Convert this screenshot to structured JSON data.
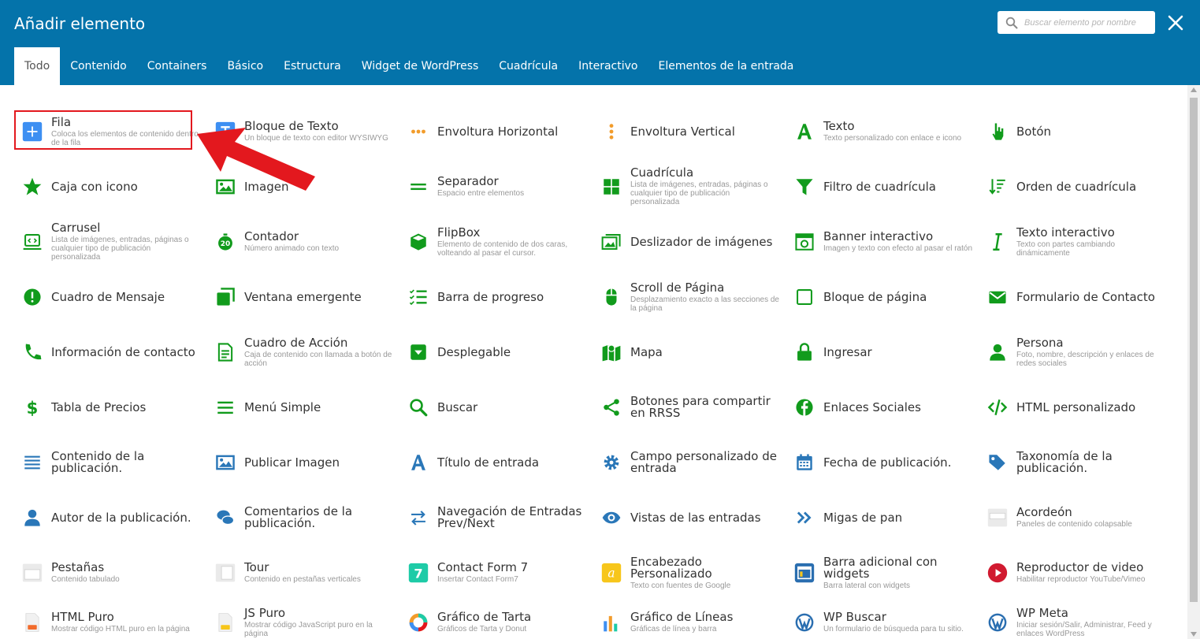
{
  "header": {
    "title": "Añadir elemento",
    "search_placeholder": "Buscar elemento por nombre",
    "colors": {
      "bar": "#0473aa",
      "icon_green": "#119b1c",
      "icon_blue": "#2a77b8",
      "highlight": "#e3181e"
    }
  },
  "tabs": [
    {
      "label": "Todo",
      "active": true
    },
    {
      "label": "Contenido"
    },
    {
      "label": "Containers"
    },
    {
      "label": "Básico"
    },
    {
      "label": "Estructura"
    },
    {
      "label": "Widget de WordPress"
    },
    {
      "label": "Cuadrícula"
    },
    {
      "label": "Interactivo"
    },
    {
      "label": "Elementos de la entrada"
    }
  ],
  "elements": [
    {
      "name": "Fila",
      "desc": "Coloca los elementos de contenido dentro de la fila",
      "icon": "plus-icon"
    },
    {
      "name": "Bloque de Texto",
      "desc": "Un bloque de texto con editor WYSIWYG",
      "icon": "text-block-icon"
    },
    {
      "name": "Envoltura Horizontal",
      "desc": "",
      "icon": "dots-horizontal-icon"
    },
    {
      "name": "Envoltura Vertical",
      "desc": "",
      "icon": "dots-vertical-icon"
    },
    {
      "name": "Texto",
      "desc": "Texto personalizado con enlace e icono",
      "icon": "font-a-icon"
    },
    {
      "name": "Botón",
      "desc": "",
      "icon": "pointer-hand-icon"
    },
    {
      "name": "Caja con icono",
      "desc": "",
      "icon": "star-icon"
    },
    {
      "name": "Imagen",
      "desc": "",
      "icon": "image-icon"
    },
    {
      "name": "Separador",
      "desc": "Espacio entre elementos",
      "icon": "separator-icon"
    },
    {
      "name": "Cuadrícula",
      "desc": "Lista de imágenes, entradas, páginas o cualquier tipo de publicación personalizada",
      "icon": "grid-icon"
    },
    {
      "name": "Filtro de cuadrícula",
      "desc": "",
      "icon": "filter-icon"
    },
    {
      "name": "Orden de cuadrícula",
      "desc": "",
      "icon": "sort-icon"
    },
    {
      "name": "Carrusel",
      "desc": "Lista de imágenes, entradas, páginas o cualquier tipo de publicación personalizada",
      "icon": "carousel-icon"
    },
    {
      "name": "Contador",
      "desc": "Número animado con texto",
      "icon": "counter-icon"
    },
    {
      "name": "FlipBox",
      "desc": "Elemento de contenido de dos caras, volteando al pasar el cursor.",
      "icon": "cube-icon"
    },
    {
      "name": "Deslizador de imágenes",
      "desc": "",
      "icon": "images-icon"
    },
    {
      "name": "Banner interactivo",
      "desc": "Imagen y texto con efecto al pasar el ratón",
      "icon": "banner-icon"
    },
    {
      "name": "Texto interactivo",
      "desc": "Texto con partes cambiando dinámicamente",
      "icon": "italic-i-icon"
    },
    {
      "name": "Cuadro de Mensaje",
      "desc": "",
      "icon": "exclamation-circle-icon"
    },
    {
      "name": "Ventana emergente",
      "desc": "",
      "icon": "window-icon"
    },
    {
      "name": "Barra de progreso",
      "desc": "",
      "icon": "tasks-icon"
    },
    {
      "name": "Scroll de Página",
      "desc": "Desplazamiento exacto a las secciones de la página",
      "icon": "mouse-icon"
    },
    {
      "name": "Bloque de página",
      "desc": "",
      "icon": "square-outline-icon"
    },
    {
      "name": "Formulario de Contacto",
      "desc": "",
      "icon": "envelope-icon"
    },
    {
      "name": "Información de contacto",
      "desc": "",
      "icon": "phone-icon"
    },
    {
      "name": "Cuadro de Acción",
      "desc": "Caja de contenido con llamada a botón de acción",
      "icon": "file-text-icon"
    },
    {
      "name": "Desplegable",
      "desc": "",
      "icon": "dropdown-icon"
    },
    {
      "name": "Mapa",
      "desc": "",
      "icon": "map-icon"
    },
    {
      "name": "Ingresar",
      "desc": "",
      "icon": "lock-icon"
    },
    {
      "name": "Persona",
      "desc": "Foto, nombre, descripción y enlaces de redes sociales",
      "icon": "user-icon"
    },
    {
      "name": "Tabla de Precios",
      "desc": "",
      "icon": "dollar-icon"
    },
    {
      "name": "Menú Simple",
      "desc": "",
      "icon": "menu-bars-icon"
    },
    {
      "name": "Buscar",
      "desc": "",
      "icon": "search-icon"
    },
    {
      "name": "Botones para compartir en RRSS",
      "desc": "",
      "icon": "share-icon"
    },
    {
      "name": "Enlaces Sociales",
      "desc": "",
      "icon": "facebook-icon"
    },
    {
      "name": "HTML personalizado",
      "desc": "",
      "icon": "code-icon"
    },
    {
      "name": "Contenido de la publicación.",
      "desc": "",
      "icon": "align-lines-icon"
    },
    {
      "name": "Publicar Imagen",
      "desc": "",
      "icon": "post-image-icon"
    },
    {
      "name": "Título de entrada",
      "desc": "",
      "icon": "font-a-icon"
    },
    {
      "name": "Campo personalizado de entrada",
      "desc": "",
      "icon": "cog-icon"
    },
    {
      "name": "Fecha de publicación.",
      "desc": "",
      "icon": "calendar-icon"
    },
    {
      "name": "Taxonomía de la publicación.",
      "desc": "",
      "icon": "tags-icon"
    },
    {
      "name": "Autor de la publicación.",
      "desc": "",
      "icon": "author-icon"
    },
    {
      "name": "Comentarios de la publicación.",
      "desc": "",
      "icon": "comments-icon"
    },
    {
      "name": "Navegación de Entradas Prev/Next",
      "desc": "",
      "icon": "exchange-arrows-icon"
    },
    {
      "name": "Vistas de las entradas",
      "desc": "",
      "icon": "eye-icon"
    },
    {
      "name": "Migas de pan",
      "desc": "",
      "icon": "double-chevron-icon"
    },
    {
      "name": "Acordeón",
      "desc": "Paneles de contenido colapsable",
      "icon": "accordion-icon"
    },
    {
      "name": "Pestañas",
      "desc": "Contenido tabulado",
      "icon": "tabs-icon"
    },
    {
      "name": "Tour",
      "desc": "Contenido en pestañas verticales",
      "icon": "tour-icon"
    },
    {
      "name": "Contact Form 7",
      "desc": "Insertar Contact Form7",
      "icon": "contact-form-7-icon"
    },
    {
      "name": "Encabezado Personalizado",
      "desc": "Texto con fuentes de Google",
      "icon": "google-fonts-icon"
    },
    {
      "name": "Barra adicional con widgets",
      "desc": "Barra lateral con widgets",
      "icon": "sidebar-widget-icon"
    },
    {
      "name": "Reproductor de video",
      "desc": "Habilitar reproductor YouTube/Vimeo",
      "icon": "play-circle-icon"
    },
    {
      "name": "HTML Puro",
      "desc": "Mostrar código HTML puro en la página",
      "icon": "html-file-icon"
    },
    {
      "name": "JS Puro",
      "desc": "Mostrar código JavaScript puro en la página",
      "icon": "js-file-icon"
    },
    {
      "name": "Gráfico de Tarta",
      "desc": "Gráficos de Tarta y Donut",
      "icon": "pie-chart-icon"
    },
    {
      "name": "Gráfico de Líneas",
      "desc": "Gráficas de línea y barra",
      "icon": "bar-chart-icon"
    },
    {
      "name": "WP Buscar",
      "desc": "Un formulario de búsqueda para tu sitio.",
      "icon": "wordpress-icon"
    },
    {
      "name": "WP Meta",
      "desc": "Iniciar sesión/Salir, Administrar, Feed y enlaces WordPress",
      "icon": "wordpress-icon"
    }
  ]
}
